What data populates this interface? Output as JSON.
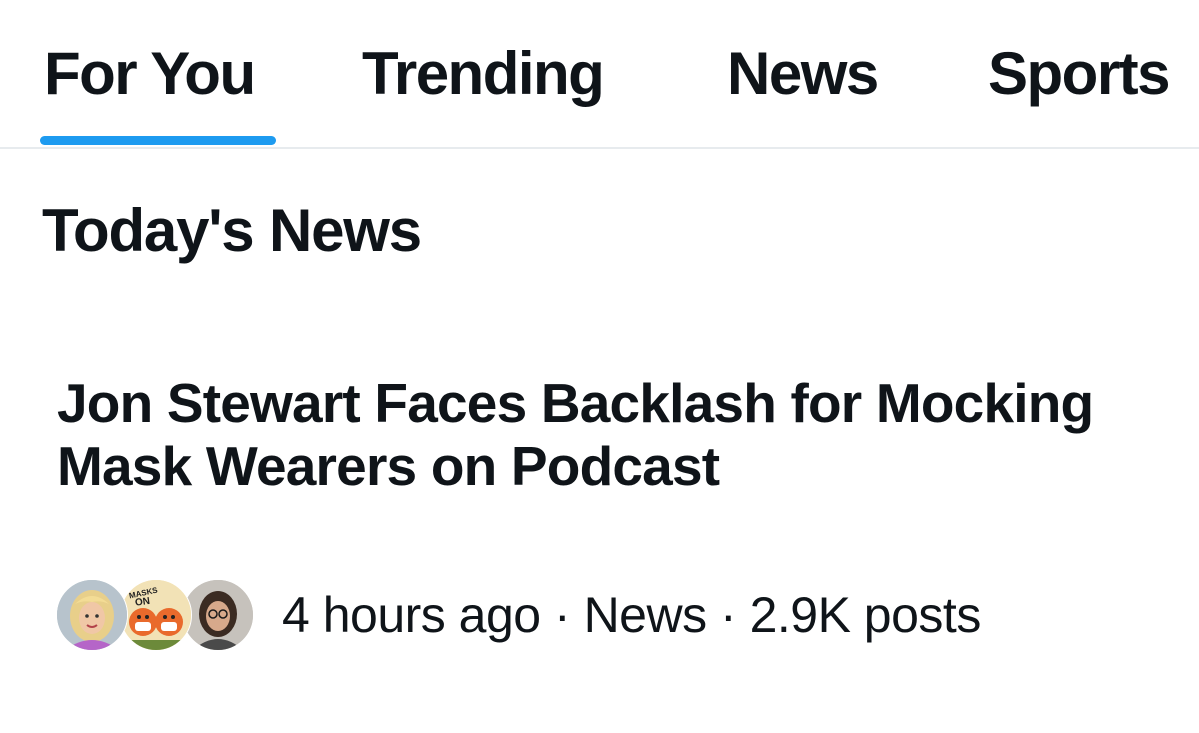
{
  "tabs": [
    {
      "label": "For You",
      "selected": true
    },
    {
      "label": "Trending",
      "selected": false
    },
    {
      "label": "News",
      "selected": false
    },
    {
      "label": "Sports",
      "selected": false
    }
  ],
  "colors": {
    "accent": "#1d9bf0",
    "text": "#0f1419",
    "divider": "#e7ebee"
  },
  "section": {
    "title": "Today's News"
  },
  "story": {
    "headline": "Jon Stewart Faces Backlash for Mocking Mask Wearers on Podcast",
    "time": "4 hours ago",
    "category": "News",
    "posts": "2.9K posts",
    "separator": "·",
    "avatars": [
      {
        "name": "avatar-woman-blonde"
      },
      {
        "name": "avatar-masks-on-cartoon",
        "badge_text": "MASKS ON"
      },
      {
        "name": "avatar-woman-glasses"
      }
    ]
  }
}
